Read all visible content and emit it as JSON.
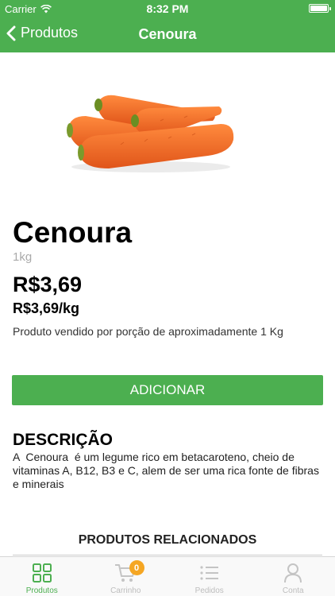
{
  "status_bar": {
    "carrier": "Carrier",
    "time": "8:32 PM"
  },
  "nav": {
    "back_label": "Produtos",
    "title": "Cenoura"
  },
  "product": {
    "name": "Cenoura",
    "unit": "1kg",
    "price": "R$3,69",
    "price_per_kg": "R$3,69/kg",
    "note": "Produto vendido por porção de aproximadamente 1 Kg"
  },
  "actions": {
    "add_label": "ADICIONAR"
  },
  "description": {
    "title": "DESCRIÇÃO",
    "text": "A  Cenoura  é um legume rico em betacaroteno, cheio de vitaminas A, B12, B3 e C, alem de ser uma rica fonte de fibras e minerais"
  },
  "related": {
    "title": "PRODUTOS RELACIONADOS"
  },
  "tabs": [
    {
      "label": "Produtos",
      "icon": "grid-icon",
      "active": true
    },
    {
      "label": "Carrinho",
      "icon": "cart-icon",
      "badge": "0"
    },
    {
      "label": "Pedidos",
      "icon": "list-icon"
    },
    {
      "label": "Conta",
      "icon": "user-icon"
    }
  ],
  "colors": {
    "primary": "#4caf50",
    "badge": "#f5a623",
    "inactive": "#bdbdbd"
  }
}
